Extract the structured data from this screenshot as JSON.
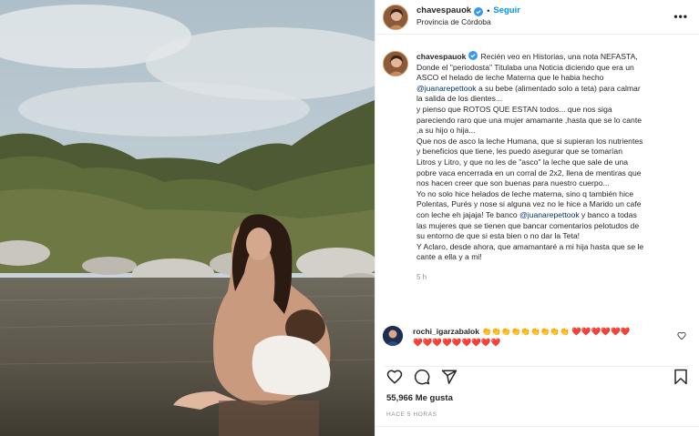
{
  "header": {
    "username": "chavespauok",
    "separator": "•",
    "follow_label": "Seguir",
    "location": "Provincia de Córdoba",
    "more_label": "•••"
  },
  "caption": {
    "username": "chavespauok",
    "lines": [
      "Recién veo en Historias, una nota NEFASTA,",
      "Donde el \"periodosta\" Titulaba una Noticia diciendo que era un",
      "ASCO el helado de leche Materna que le habia hecho"
    ],
    "mention1": "@juanarepettook",
    "line4_rest": " a su bebe (alimentado solo a teta) para calmar",
    "lines2": [
      "la salida de los dientes...",
      "y pienso que ROTOS QUE ESTAN todos... que nos siga",
      "pareciendo raro que una mujer amamante ,hasta que se lo cante",
      ",a su hijo o hija...",
      "Que nos de asco la leche Humana, que si supieran los nutrientes",
      "y beneficios que tiene, les puedo asegurar que se tomarían",
      "Litros y Litro, y que no les de \"asco\" la leche que sale de una",
      "pobre vaca encerrada en un corral de 2x2, llena de mentiras que",
      "nos hacen creer que son buenas para nuestro cuerpo...",
      "Yo no solo hice helados de leche materna, sino q también hice",
      "Polentas, Purés y nose si alguna vez no le hice a Marido un cafe"
    ],
    "line15_start": "con leche eh jajaja! Te banco ",
    "mention2": "@juanarepettook",
    "line15_end": " y banco a todas",
    "lines3": [
      "las mujeres que se tienen que bancar comentarios pelotudos de",
      "su entorno de que si esta bien o no dar la Teta!",
      "Y Aclaro, desde ahora, que amamantaré a mi hija hasta que se le",
      "cante a ella y a mi!"
    ],
    "time": "5 h"
  },
  "comment": {
    "username": "rochi_igarzabalok",
    "emojis_line1": "👏👏👏👏👏👏👏👏👏 ❤️❤️❤️❤️❤️❤️",
    "emojis_line2": "❤️❤️❤️❤️❤️❤️❤️❤️❤️"
  },
  "actions": {
    "like_icon": "heart-icon",
    "comment_icon": "comment-icon",
    "share_icon": "share-icon",
    "save_icon": "bookmark-icon"
  },
  "likes": {
    "count": "55,966",
    "label": "Me gusta"
  },
  "time_ago": "HACE 5 HORAS",
  "colors": {
    "link": "#0095f6",
    "mention": "#00376b",
    "verified": "#3897f0",
    "muted": "#8e8e8e",
    "heart": "#ed4956"
  }
}
